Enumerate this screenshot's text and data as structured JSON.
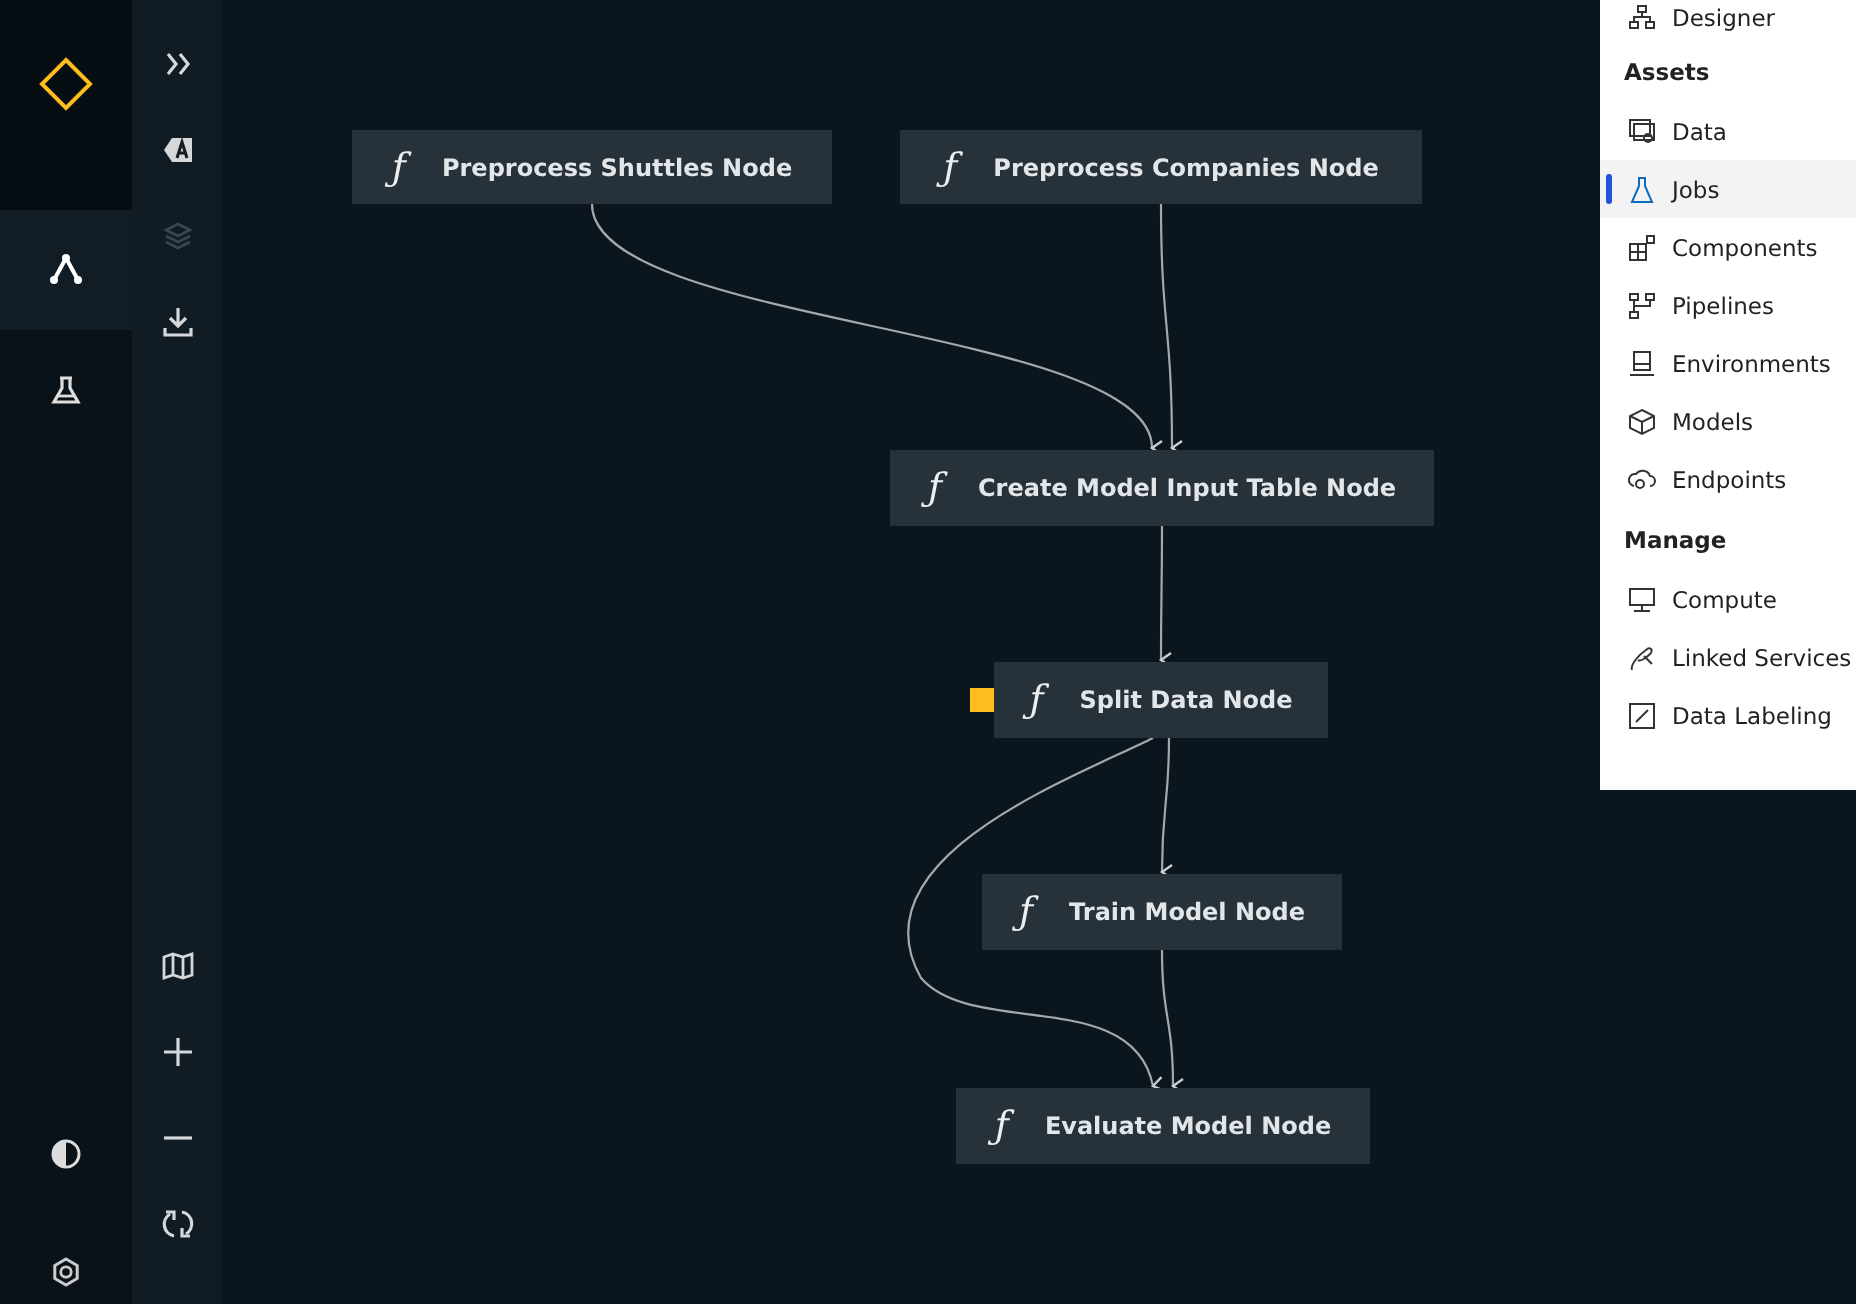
{
  "main_nav": [
    {
      "selected": true
    },
    {
      "selected": false
    }
  ],
  "toolbar": [
    {
      "disabled": false
    },
    {
      "disabled": false
    },
    {
      "disabled": true
    },
    {
      "disabled": false
    }
  ],
  "view_controls": [
    {
      "disabled": false
    },
    {
      "disabled": false
    },
    {
      "disabled": false
    },
    {
      "disabled": false
    }
  ],
  "nodes": [
    {
      "label": "Preprocess Shuttles Node",
      "icon": "ƒ",
      "has_parameters": false
    },
    {
      "label": "Preprocess Companies Node",
      "icon": "ƒ",
      "has_parameters": false
    },
    {
      "label": "Create Model Input Table Node",
      "icon": "ƒ",
      "has_parameters": false
    },
    {
      "label": "Split Data Node",
      "icon": "ƒ",
      "has_parameters": true
    },
    {
      "label": "Train Model Node",
      "icon": "ƒ",
      "has_parameters": false
    },
    {
      "label": "Evaluate Model Node",
      "icon": "ƒ",
      "has_parameters": false
    }
  ],
  "side_menu": [
    {
      "kind": "item",
      "label": "Designer",
      "selected": false
    },
    {
      "kind": "heading",
      "label": "Assets"
    },
    {
      "kind": "item",
      "label": "Data",
      "selected": false
    },
    {
      "kind": "item",
      "label": "Jobs",
      "selected": true
    },
    {
      "kind": "item",
      "label": "Components",
      "selected": false
    },
    {
      "kind": "item",
      "label": "Pipelines",
      "selected": false
    },
    {
      "kind": "item",
      "label": "Environments",
      "selected": false
    },
    {
      "kind": "item",
      "label": "Models",
      "selected": false
    },
    {
      "kind": "item",
      "label": "Endpoints",
      "selected": false
    },
    {
      "kind": "heading",
      "label": "Manage"
    },
    {
      "kind": "item",
      "label": "Compute",
      "selected": false
    },
    {
      "kind": "item",
      "label": "Linked Services",
      "selected": false
    },
    {
      "kind": "item",
      "label": "Data Labeling",
      "selected": false
    }
  ]
}
